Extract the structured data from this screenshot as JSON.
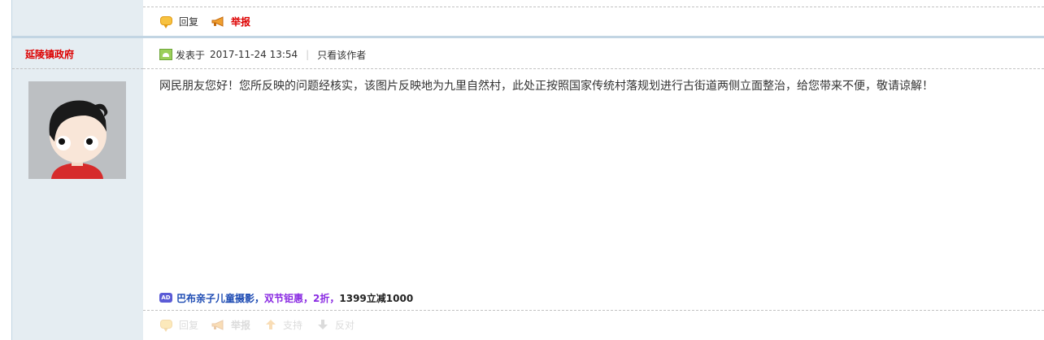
{
  "top_actions": {
    "reply_label": "回复",
    "report_label": "举报"
  },
  "author": {
    "name": "延陵镇政府"
  },
  "post": {
    "posted_prefix": "发表于",
    "posted_time": "2017-11-24 13:54",
    "separator": "|",
    "only_author_label": "只看该作者",
    "content": "网民朋友您好！您所反映的问题经核实，该图片反映地为九里自然村，此处正按照国家传统村落规划进行古街道两侧立面整治，给您带来不便，敬请谅解！"
  },
  "ad": {
    "badge": "AD",
    "part1": "巴布亲子儿童摄影，",
    "part2": "双节钜惠，2折，",
    "part3": "1399立减1000"
  },
  "bottom_actions": {
    "reply_label": "回复",
    "report_label": "举报",
    "support_label": "支持",
    "oppose_label": "反对"
  },
  "colors": {
    "sidebar_bg": "#e5edf2",
    "border": "#c2d5e3",
    "author_red": "#dd0000",
    "ad_blue": "#1d4bb3",
    "ad_purple": "#8a2be2"
  }
}
